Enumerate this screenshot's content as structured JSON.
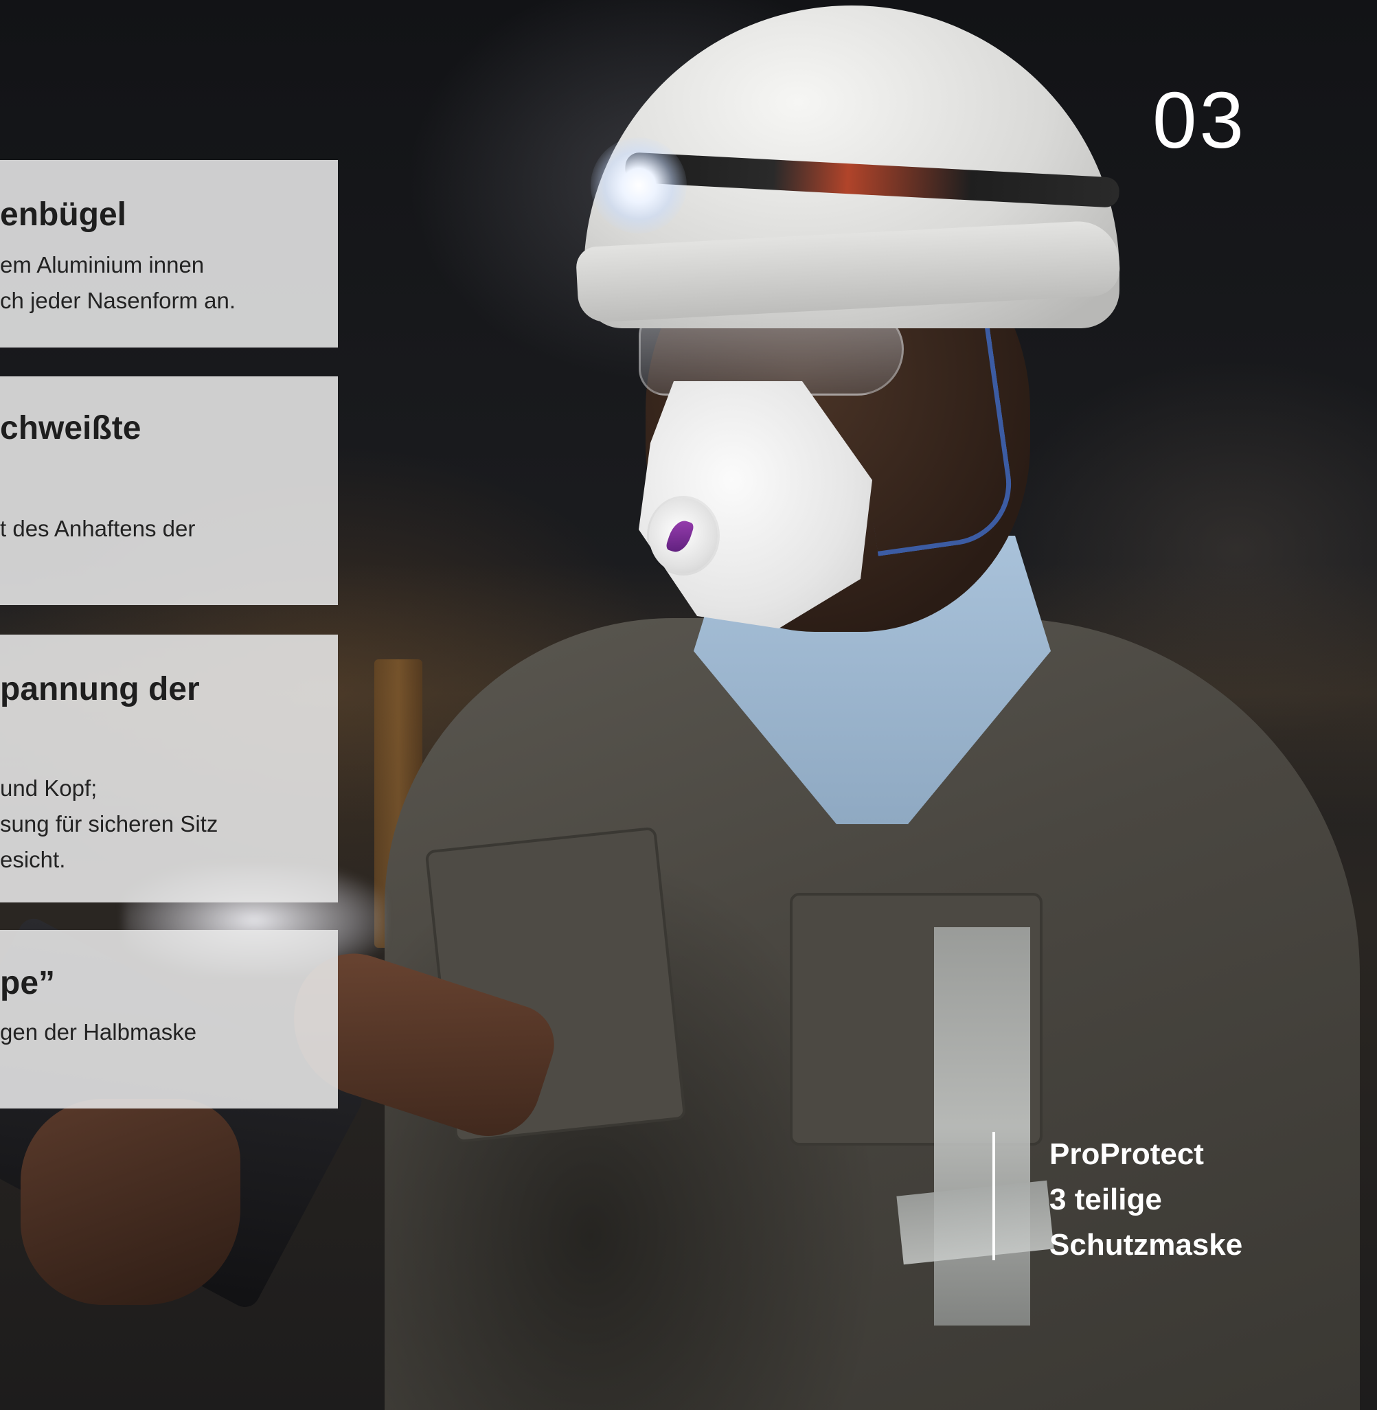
{
  "page": {
    "number": "03"
  },
  "panels": [
    {
      "title_lines": [
        "enbügel"
      ],
      "text_lines": [
        "em Aluminium innen",
        "ch jeder Nasenform an."
      ]
    },
    {
      "title_lines": [
        "chweißte"
      ],
      "text_lines": [
        "t des Anhaftens der"
      ]
    },
    {
      "title_lines": [
        "pannung der"
      ],
      "text_lines": [
        " und Kopf;",
        "sung für sicheren Sitz",
        "esicht."
      ]
    },
    {
      "title_lines": [
        "pe”"
      ],
      "text_lines": [
        "gen der Halbmaske"
      ]
    }
  ],
  "product": {
    "lines": [
      "ProProtect",
      "3 teilige",
      "Schutzmaske"
    ]
  },
  "colors": {
    "panel_background": "#e8e8e8",
    "panel_text": "#1e1e1e",
    "overlay_text": "#ffffff",
    "mask_strap": "#3e63b3",
    "mask_logo": "#7b2d9c"
  }
}
